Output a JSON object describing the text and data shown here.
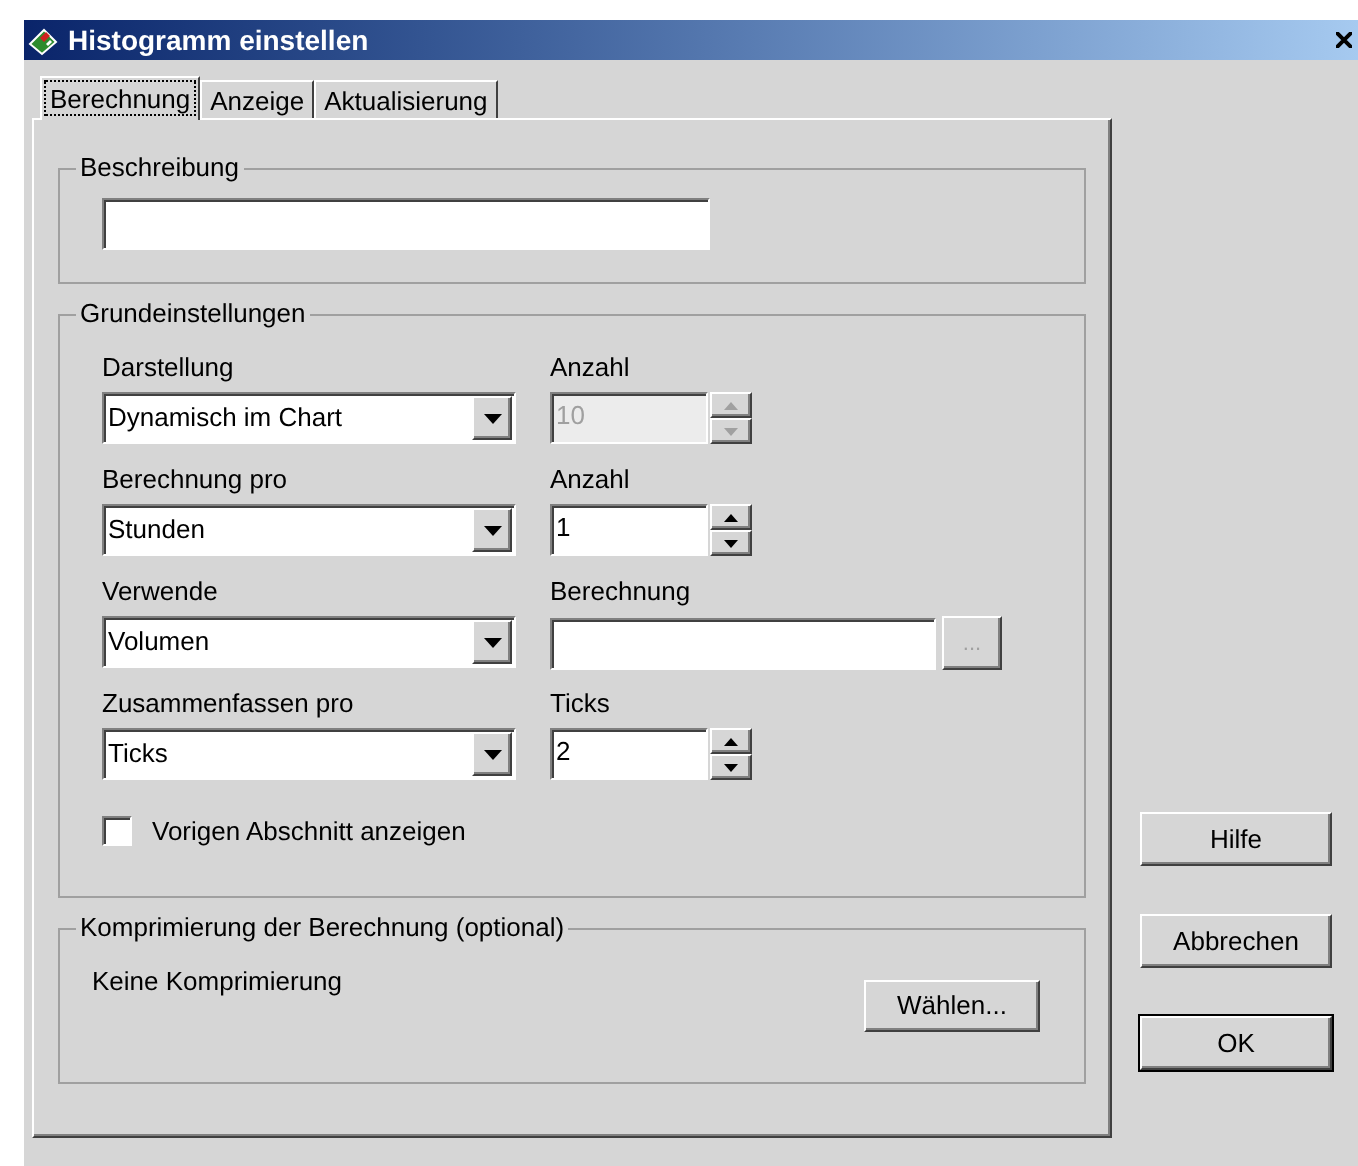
{
  "window": {
    "title": "Histogramm einstellen"
  },
  "tabs": [
    {
      "label": "Berechnung",
      "selected": true
    },
    {
      "label": "Anzeige",
      "selected": false
    },
    {
      "label": "Aktualisierung",
      "selected": false
    }
  ],
  "description_group": {
    "legend": "Beschreibung"
  },
  "basic_group": {
    "legend": "Grundeinstellungen",
    "rows": [
      {
        "left": {
          "label": "Darstellung",
          "value": "Dynamisch im Chart"
        },
        "right": {
          "kind": "spinner",
          "label": "Anzahl",
          "value": "10",
          "disabled": true
        }
      },
      {
        "left": {
          "label": "Berechnung pro",
          "value": "Stunden"
        },
        "right": {
          "kind": "spinner",
          "label": "Anzahl",
          "value": "1",
          "disabled": false
        }
      },
      {
        "left": {
          "label": "Verwende",
          "value": "Volumen"
        },
        "right": {
          "kind": "browse",
          "label": "Berechnung",
          "button": "...",
          "disabled": true
        }
      },
      {
        "left": {
          "label": "Zusammenfassen pro",
          "value": "Ticks"
        },
        "right": {
          "kind": "spinner",
          "label": "Ticks",
          "value": "2",
          "disabled": false
        }
      }
    ],
    "checkbox": {
      "label": "Vorigen Abschnitt anzeigen",
      "checked": false
    }
  },
  "compression_group": {
    "legend": "Komprimierung der Berechnung (optional)",
    "text": "Keine Komprimierung",
    "button": "Wählen..."
  },
  "buttons": [
    {
      "label": "Hilfe",
      "default": false
    },
    {
      "label": "Abbrechen",
      "default": false
    },
    {
      "label": "OK",
      "default": true
    }
  ]
}
